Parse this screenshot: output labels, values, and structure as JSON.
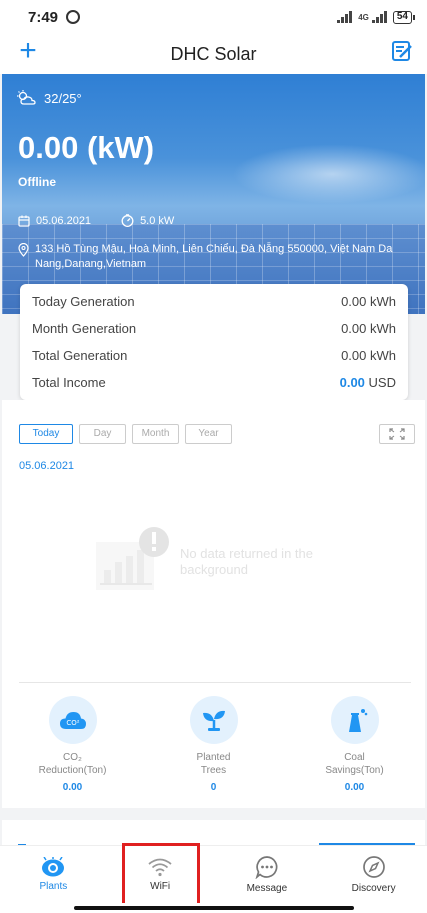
{
  "status_bar": {
    "time": "7:49",
    "network": "4G",
    "battery": "54"
  },
  "header": {
    "title": "DHC Solar",
    "add_label": "+"
  },
  "hero": {
    "weather": "32/25°",
    "power": "0.00 (kW)",
    "status": "Offline",
    "date": "05.06.2021",
    "capacity": "5.0 kW",
    "address": "133 Hồ Tùng Mậu, Hoà Minh, Liên Chiểu, Đà Nẵng 550000, Việt Nam Da Nang,Danang,Vietnam"
  },
  "stats": [
    {
      "label": "Today Generation",
      "value": "0.00 kWh"
    },
    {
      "label": "Month Generation",
      "value": "0.00 kWh"
    },
    {
      "label": "Total Generation",
      "value": "0.00 kWh"
    },
    {
      "label": "Total Income",
      "value": "0.00",
      "unit": "USD"
    }
  ],
  "chart": {
    "tabs": [
      "Today",
      "Day",
      "Month",
      "Year"
    ],
    "active_tab": "Today",
    "date": "05.06.2021",
    "no_data": "No data returned in the background"
  },
  "environment": [
    {
      "label_line1": "CO₂",
      "label_line2": "Reduction(Ton)",
      "value": "0.00",
      "icon": "co2-cloud-icon"
    },
    {
      "label_line1": "Planted",
      "label_line2": "Trees",
      "value": "0",
      "icon": "sprout-icon"
    },
    {
      "label_line1": "Coal",
      "label_line2": "Savings(Ton)",
      "value": "0.00",
      "icon": "coal-plant-icon"
    }
  ],
  "nav": [
    {
      "label": "Plants",
      "icon": "plants-eye-icon",
      "active": true
    },
    {
      "label": "WiFi",
      "icon": "wifi-icon",
      "active": false
    },
    {
      "label": "Message",
      "icon": "message-icon",
      "active": false
    },
    {
      "label": "Discovery",
      "icon": "compass-icon",
      "active": false
    }
  ],
  "colors": {
    "accent": "#1e88e5",
    "highlight": "#e02020"
  }
}
